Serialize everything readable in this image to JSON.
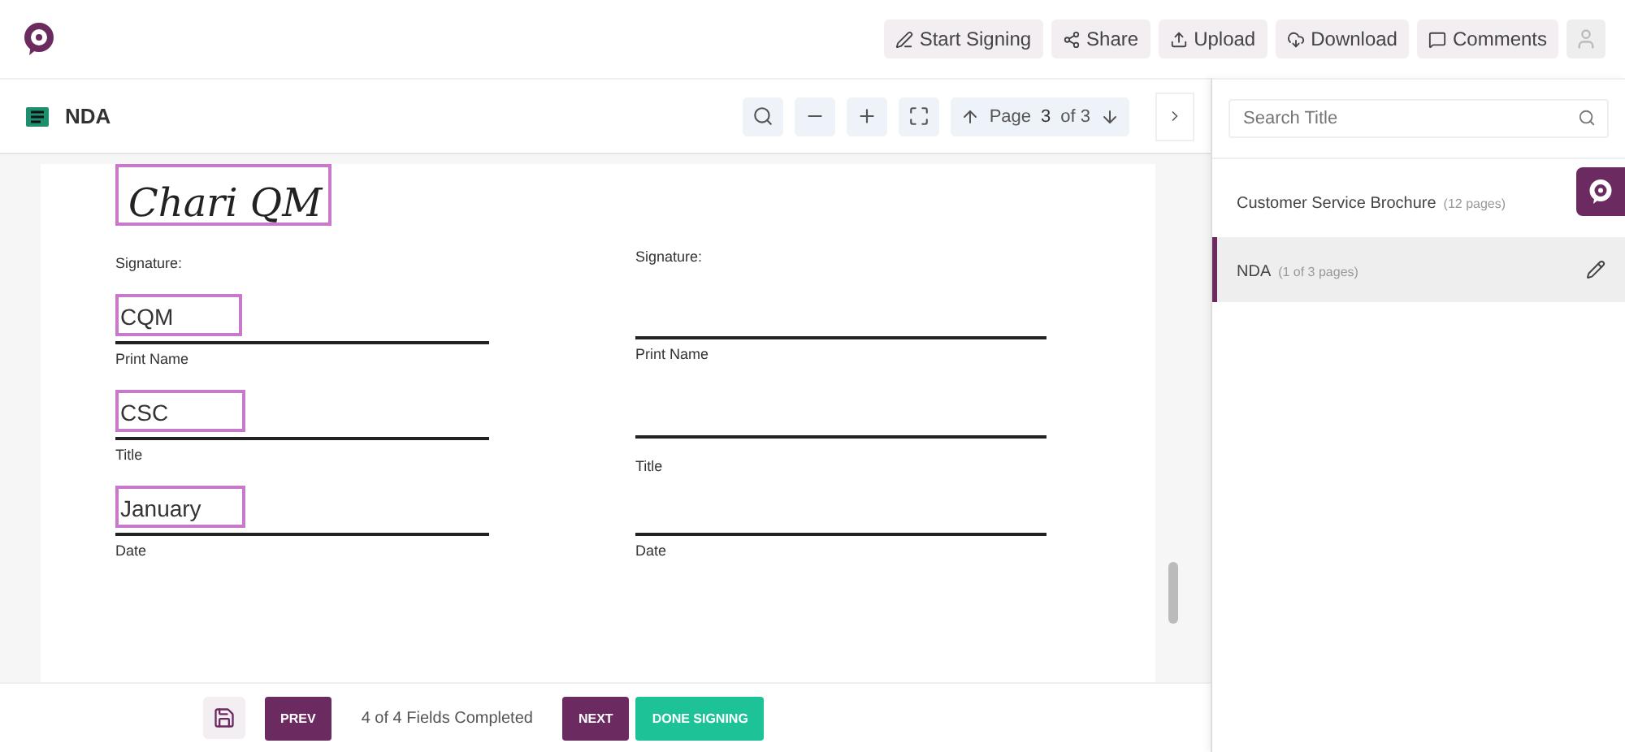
{
  "header": {
    "actions": [
      {
        "kind": "sign",
        "label": "Start Signing"
      },
      {
        "kind": "share",
        "label": "Share"
      },
      {
        "kind": "upload",
        "label": "Upload"
      },
      {
        "kind": "download",
        "label": "Download"
      },
      {
        "kind": "comments",
        "label": "Comments"
      }
    ]
  },
  "viewer": {
    "title": "NDA",
    "page": {
      "label": "Page",
      "current": "3",
      "total": "of 3"
    }
  },
  "document": {
    "left": {
      "signature": "Chari QM",
      "signature_label": "Signature:",
      "fields": [
        {
          "value": "CQM",
          "label": "Print Name"
        },
        {
          "value": "CSC",
          "label": "Title"
        },
        {
          "value": "January",
          "label": "Date"
        }
      ]
    },
    "right": {
      "signature_label": "Signature:",
      "labels": [
        "Print Name",
        "Title",
        "Date"
      ]
    }
  },
  "sidebar": {
    "search": {
      "placeholder": "Search Title"
    },
    "documents": [
      {
        "title": "Customer Service Brochure",
        "pages": "(12 pages)",
        "selected": false
      },
      {
        "title": "NDA",
        "pages": "(1 of 3 pages)",
        "selected": true
      }
    ]
  },
  "footer": {
    "prev": "PREV",
    "status": "4 of 4 Fields Completed",
    "next": "NEXT",
    "done": "DONE SIGNING"
  }
}
